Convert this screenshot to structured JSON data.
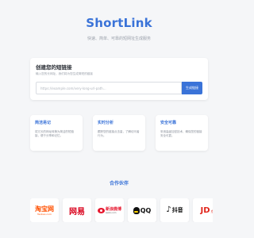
{
  "header": {
    "brand": "ShortLink",
    "tagline": "快速、简单、可靠的短网址生成服务"
  },
  "shorten": {
    "title": "创建您的短链接",
    "description": "输入您的长网址，我们将为您生成简短的链接",
    "input_placeholder": "https://example.com/very-long-url-path...",
    "input_value": "",
    "submit_label": "生成链接"
  },
  "features": [
    {
      "title": "简洁易记",
      "description": "将冗长的网址转换为简洁的短链接，便于分享和记忆。"
    },
    {
      "title": "实时分析",
      "description": "跟踪您的链接点击量，了解访问者行为。"
    },
    {
      "title": "安全可靠",
      "description": "采用高级加密技术，确保您的链接安全可靠。"
    }
  ],
  "partners": {
    "title": "合作伙伴",
    "logos": {
      "taobao": {
        "main": "淘宝网",
        "sub": "Taobao.com"
      },
      "netease": {
        "main": "网易"
      },
      "weibo": {
        "main": "新浪微博",
        "sub": "weibo.com"
      },
      "qq": {
        "main": "QQ"
      },
      "douyin": {
        "main": "抖音"
      },
      "jd": {
        "main": "JD",
        "sub": "京东"
      }
    }
  },
  "colors": {
    "accent": "#3a73d8",
    "background": "#f5f6f8"
  }
}
